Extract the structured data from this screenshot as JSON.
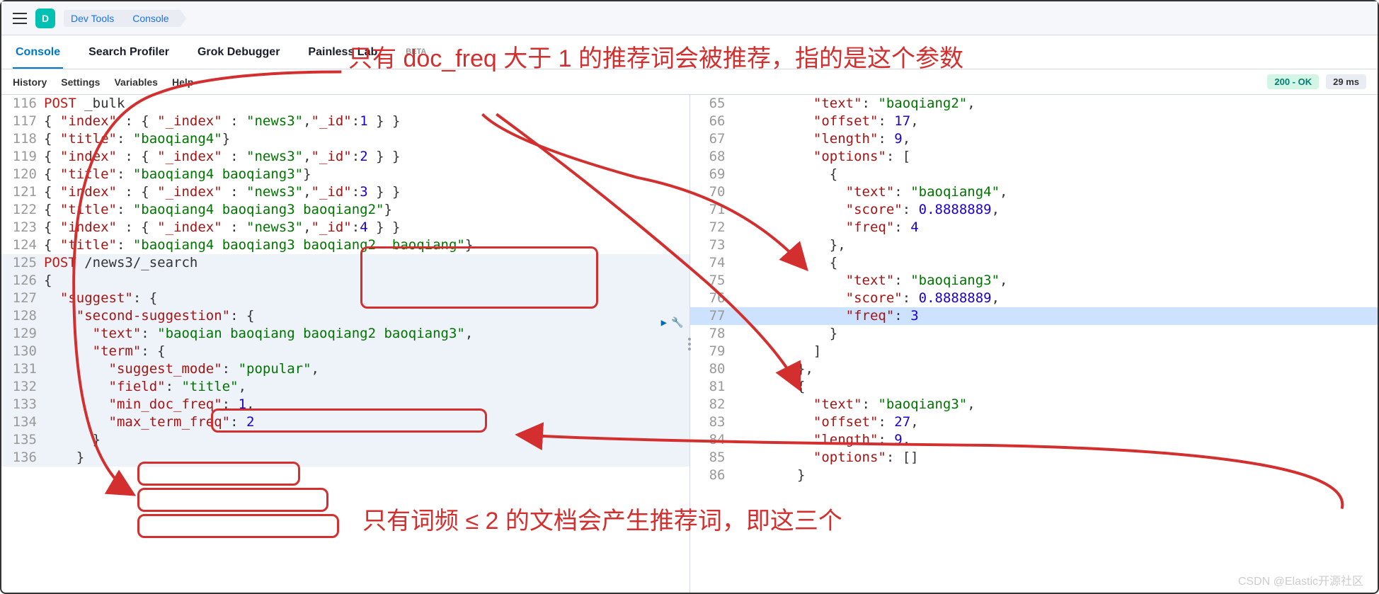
{
  "topbar": {
    "logo_letter": "D"
  },
  "breadcrumb": [
    "Dev Tools",
    "Console"
  ],
  "tabs": [
    "Console",
    "Search Profiler",
    "Grok Debugger",
    "Painless Lab",
    "BETA"
  ],
  "active_tab": 0,
  "subbar": [
    "History",
    "Settings",
    "Variables",
    "Help"
  ],
  "status": {
    "code": "200 - OK",
    "time": "29 ms"
  },
  "annotations": {
    "top": "只有 doc_freq 大于 1 的推荐词会被推荐，指的是这个参数",
    "bottom": "只有词频 ≤ 2 的文档会产生推荐词，即这三个"
  },
  "watermark": "CSDN @Elastic开源社区",
  "left_code": [
    {
      "n": 116,
      "tokens": [
        [
          "kw",
          "POST"
        ],
        [
          "punc",
          " _bulk"
        ]
      ]
    },
    {
      "n": 117,
      "tokens": [
        [
          "punc",
          "{ "
        ],
        [
          "prop",
          "\"index\""
        ],
        [
          "punc",
          " : { "
        ],
        [
          "prop",
          "\"_index\""
        ],
        [
          "punc",
          " : "
        ],
        [
          "str",
          "\"news3\""
        ],
        [
          "punc",
          ","
        ],
        [
          "prop",
          "\"_id\""
        ],
        [
          "punc",
          ":"
        ],
        [
          "num",
          "1"
        ],
        [
          "punc",
          " } }"
        ]
      ]
    },
    {
      "n": 118,
      "tokens": [
        [
          "punc",
          "{ "
        ],
        [
          "prop",
          "\"title\""
        ],
        [
          "punc",
          ": "
        ],
        [
          "str",
          "\"baoqiang4\""
        ],
        [
          "punc",
          "}"
        ]
      ]
    },
    {
      "n": 119,
      "tokens": [
        [
          "punc",
          "{ "
        ],
        [
          "prop",
          "\"index\""
        ],
        [
          "punc",
          " : { "
        ],
        [
          "prop",
          "\"_index\""
        ],
        [
          "punc",
          " : "
        ],
        [
          "str",
          "\"news3\""
        ],
        [
          "punc",
          ","
        ],
        [
          "prop",
          "\"_id\""
        ],
        [
          "punc",
          ":"
        ],
        [
          "num",
          "2"
        ],
        [
          "punc",
          " } }"
        ]
      ]
    },
    {
      "n": 120,
      "tokens": [
        [
          "punc",
          "{ "
        ],
        [
          "prop",
          "\"title\""
        ],
        [
          "punc",
          ": "
        ],
        [
          "str",
          "\"baoqiang4 baoqiang3\""
        ],
        [
          "punc",
          "}"
        ]
      ]
    },
    {
      "n": 121,
      "tokens": [
        [
          "punc",
          "{ "
        ],
        [
          "prop",
          "\"index\""
        ],
        [
          "punc",
          " : { "
        ],
        [
          "prop",
          "\"_index\""
        ],
        [
          "punc",
          " : "
        ],
        [
          "str",
          "\"news3\""
        ],
        [
          "punc",
          ","
        ],
        [
          "prop",
          "\"_id\""
        ],
        [
          "punc",
          ":"
        ],
        [
          "num",
          "3"
        ],
        [
          "punc",
          " } }"
        ]
      ]
    },
    {
      "n": 122,
      "tokens": [
        [
          "punc",
          "{ "
        ],
        [
          "prop",
          "\"title\""
        ],
        [
          "punc",
          ": "
        ],
        [
          "str",
          "\"baoqiang4 baoqiang3 baoqiang2\""
        ],
        [
          "punc",
          "}"
        ]
      ]
    },
    {
      "n": 123,
      "tokens": [
        [
          "punc",
          "{ "
        ],
        [
          "prop",
          "\"index\""
        ],
        [
          "punc",
          " : { "
        ],
        [
          "prop",
          "\"_index\""
        ],
        [
          "punc",
          " : "
        ],
        [
          "str",
          "\"news3\""
        ],
        [
          "punc",
          ","
        ],
        [
          "prop",
          "\"_id\""
        ],
        [
          "punc",
          ":"
        ],
        [
          "num",
          "4"
        ],
        [
          "punc",
          " } }"
        ]
      ]
    },
    {
      "n": 124,
      "tokens": [
        [
          "punc",
          "{ "
        ],
        [
          "prop",
          "\"title\""
        ],
        [
          "punc",
          ": "
        ],
        [
          "str",
          "\"baoqiang4 baoqiang3 baoqiang2  baoqiang\""
        ],
        [
          "punc",
          "}"
        ]
      ]
    },
    {
      "n": 125,
      "hl": true,
      "tokens": [
        [
          "kw",
          "POST"
        ],
        [
          "punc",
          " /news3/_search"
        ]
      ]
    },
    {
      "n": 126,
      "hl": true,
      "tokens": [
        [
          "punc",
          "{"
        ]
      ]
    },
    {
      "n": 127,
      "hl": true,
      "tokens": [
        [
          "punc",
          "  "
        ],
        [
          "prop",
          "\"suggest\""
        ],
        [
          "punc",
          ": {"
        ]
      ]
    },
    {
      "n": 128,
      "hl": true,
      "tokens": [
        [
          "punc",
          "    "
        ],
        [
          "prop",
          "\"second-suggestion\""
        ],
        [
          "punc",
          ": {"
        ]
      ]
    },
    {
      "n": 129,
      "hl": true,
      "tokens": [
        [
          "punc",
          "      "
        ],
        [
          "prop",
          "\"text\""
        ],
        [
          "punc",
          ": "
        ],
        [
          "str",
          "\"baoqian baoqiang baoqiang2 baoqiang3\""
        ],
        [
          "punc",
          ","
        ]
      ]
    },
    {
      "n": 130,
      "hl": true,
      "tokens": [
        [
          "punc",
          "      "
        ],
        [
          "prop",
          "\"term\""
        ],
        [
          "punc",
          ": {"
        ]
      ]
    },
    {
      "n": 131,
      "hl": true,
      "tokens": [
        [
          "punc",
          "        "
        ],
        [
          "prop",
          "\"suggest_mode\""
        ],
        [
          "punc",
          ": "
        ],
        [
          "str",
          "\"popular\""
        ],
        [
          "punc",
          ","
        ]
      ]
    },
    {
      "n": 132,
      "hl": true,
      "tokens": [
        [
          "punc",
          "        "
        ],
        [
          "prop",
          "\"field\""
        ],
        [
          "punc",
          ": "
        ],
        [
          "str",
          "\"title\""
        ],
        [
          "punc",
          ","
        ]
      ]
    },
    {
      "n": 133,
      "hl": true,
      "tokens": [
        [
          "punc",
          "        "
        ],
        [
          "prop",
          "\"min_doc_freq\""
        ],
        [
          "punc",
          ": "
        ],
        [
          "num",
          "1"
        ],
        [
          "punc",
          ","
        ]
      ]
    },
    {
      "n": 134,
      "hl": true,
      "tokens": [
        [
          "punc",
          "        "
        ],
        [
          "prop",
          "\"max_term_freq\""
        ],
        [
          "punc",
          ": "
        ],
        [
          "num",
          "2"
        ]
      ]
    },
    {
      "n": 135,
      "hl": true,
      "tokens": [
        [
          "punc",
          "      }"
        ]
      ]
    },
    {
      "n": 136,
      "hl": true,
      "tokens": [
        [
          "punc",
          "    }"
        ]
      ]
    }
  ],
  "right_code": [
    {
      "n": 65,
      "tokens": [
        [
          "punc",
          "          "
        ],
        [
          "prop",
          "\"text\""
        ],
        [
          "punc",
          ": "
        ],
        [
          "str",
          "\"baoqiang2\""
        ],
        [
          "punc",
          ","
        ]
      ]
    },
    {
      "n": 66,
      "tokens": [
        [
          "punc",
          "          "
        ],
        [
          "prop",
          "\"offset\""
        ],
        [
          "punc",
          ": "
        ],
        [
          "num",
          "17"
        ],
        [
          "punc",
          ","
        ]
      ]
    },
    {
      "n": 67,
      "tokens": [
        [
          "punc",
          "          "
        ],
        [
          "prop",
          "\"length\""
        ],
        [
          "punc",
          ": "
        ],
        [
          "num",
          "9"
        ],
        [
          "punc",
          ","
        ]
      ]
    },
    {
      "n": 68,
      "tokens": [
        [
          "punc",
          "          "
        ],
        [
          "prop",
          "\"options\""
        ],
        [
          "punc",
          ": ["
        ]
      ]
    },
    {
      "n": 69,
      "tokens": [
        [
          "punc",
          "            {"
        ]
      ]
    },
    {
      "n": 70,
      "tokens": [
        [
          "punc",
          "              "
        ],
        [
          "prop",
          "\"text\""
        ],
        [
          "punc",
          ": "
        ],
        [
          "str",
          "\"baoqiang4\""
        ],
        [
          "punc",
          ","
        ]
      ]
    },
    {
      "n": 71,
      "tokens": [
        [
          "punc",
          "              "
        ],
        [
          "prop",
          "\"score\""
        ],
        [
          "punc",
          ": "
        ],
        [
          "num",
          "0.8888889"
        ],
        [
          "punc",
          ","
        ]
      ]
    },
    {
      "n": 72,
      "tokens": [
        [
          "punc",
          "              "
        ],
        [
          "prop",
          "\"freq\""
        ],
        [
          "punc",
          ": "
        ],
        [
          "num",
          "4"
        ]
      ]
    },
    {
      "n": 73,
      "tokens": [
        [
          "punc",
          "            },"
        ]
      ]
    },
    {
      "n": 74,
      "tokens": [
        [
          "punc",
          "            {"
        ]
      ]
    },
    {
      "n": 75,
      "tokens": [
        [
          "punc",
          "              "
        ],
        [
          "prop",
          "\"text\""
        ],
        [
          "punc",
          ": "
        ],
        [
          "str",
          "\"baoqiang3\""
        ],
        [
          "punc",
          ","
        ]
      ]
    },
    {
      "n": 76,
      "tokens": [
        [
          "punc",
          "              "
        ],
        [
          "prop",
          "\"score\""
        ],
        [
          "punc",
          ": "
        ],
        [
          "num",
          "0.8888889"
        ],
        [
          "punc",
          ","
        ]
      ]
    },
    {
      "n": 77,
      "hlr": true,
      "tokens": [
        [
          "punc",
          "              "
        ],
        [
          "prop",
          "\"freq\""
        ],
        [
          "punc",
          ": "
        ],
        [
          "num",
          "3"
        ]
      ]
    },
    {
      "n": 78,
      "tokens": [
        [
          "punc",
          "            }"
        ]
      ]
    },
    {
      "n": 79,
      "tokens": [
        [
          "punc",
          "          ]"
        ]
      ]
    },
    {
      "n": 80,
      "tokens": [
        [
          "punc",
          "        },"
        ]
      ]
    },
    {
      "n": 81,
      "tokens": [
        [
          "punc",
          "        {"
        ]
      ]
    },
    {
      "n": 82,
      "tokens": [
        [
          "punc",
          "          "
        ],
        [
          "prop",
          "\"text\""
        ],
        [
          "punc",
          ": "
        ],
        [
          "str",
          "\"baoqiang3\""
        ],
        [
          "punc",
          ","
        ]
      ]
    },
    {
      "n": 83,
      "tokens": [
        [
          "punc",
          "          "
        ],
        [
          "prop",
          "\"offset\""
        ],
        [
          "punc",
          ": "
        ],
        [
          "num",
          "27"
        ],
        [
          "punc",
          ","
        ]
      ]
    },
    {
      "n": 84,
      "tokens": [
        [
          "punc",
          "          "
        ],
        [
          "prop",
          "\"length\""
        ],
        [
          "punc",
          ": "
        ],
        [
          "num",
          "9"
        ],
        [
          "punc",
          ","
        ]
      ]
    },
    {
      "n": 85,
      "tokens": [
        [
          "punc",
          "          "
        ],
        [
          "prop",
          "\"options\""
        ],
        [
          "punc",
          ": []"
        ]
      ]
    },
    {
      "n": 86,
      "tokens": [
        [
          "punc",
          "        }"
        ]
      ]
    }
  ]
}
